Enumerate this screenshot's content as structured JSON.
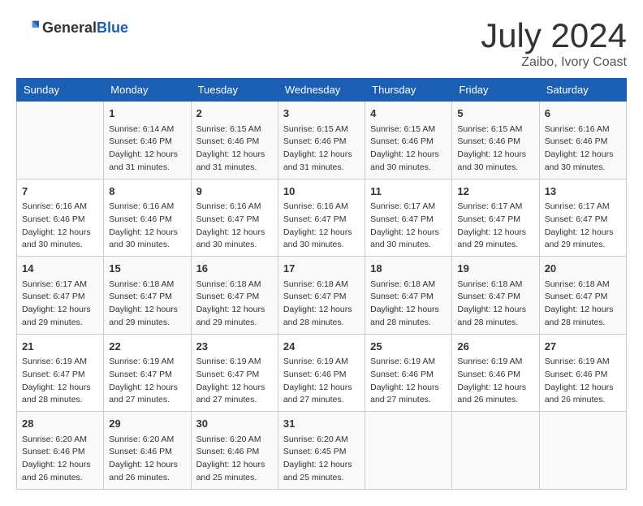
{
  "header": {
    "logo_general": "General",
    "logo_blue": "Blue",
    "month_year": "July 2024",
    "location": "Zaibo, Ivory Coast"
  },
  "days_of_week": [
    "Sunday",
    "Monday",
    "Tuesday",
    "Wednesday",
    "Thursday",
    "Friday",
    "Saturday"
  ],
  "weeks": [
    [
      {
        "day": "",
        "info": ""
      },
      {
        "day": "1",
        "info": "Sunrise: 6:14 AM\nSunset: 6:46 PM\nDaylight: 12 hours\nand 31 minutes."
      },
      {
        "day": "2",
        "info": "Sunrise: 6:15 AM\nSunset: 6:46 PM\nDaylight: 12 hours\nand 31 minutes."
      },
      {
        "day": "3",
        "info": "Sunrise: 6:15 AM\nSunset: 6:46 PM\nDaylight: 12 hours\nand 31 minutes."
      },
      {
        "day": "4",
        "info": "Sunrise: 6:15 AM\nSunset: 6:46 PM\nDaylight: 12 hours\nand 30 minutes."
      },
      {
        "day": "5",
        "info": "Sunrise: 6:15 AM\nSunset: 6:46 PM\nDaylight: 12 hours\nand 30 minutes."
      },
      {
        "day": "6",
        "info": "Sunrise: 6:16 AM\nSunset: 6:46 PM\nDaylight: 12 hours\nand 30 minutes."
      }
    ],
    [
      {
        "day": "7",
        "info": "Sunrise: 6:16 AM\nSunset: 6:46 PM\nDaylight: 12 hours\nand 30 minutes."
      },
      {
        "day": "8",
        "info": "Sunrise: 6:16 AM\nSunset: 6:46 PM\nDaylight: 12 hours\nand 30 minutes."
      },
      {
        "day": "9",
        "info": "Sunrise: 6:16 AM\nSunset: 6:47 PM\nDaylight: 12 hours\nand 30 minutes."
      },
      {
        "day": "10",
        "info": "Sunrise: 6:16 AM\nSunset: 6:47 PM\nDaylight: 12 hours\nand 30 minutes."
      },
      {
        "day": "11",
        "info": "Sunrise: 6:17 AM\nSunset: 6:47 PM\nDaylight: 12 hours\nand 30 minutes."
      },
      {
        "day": "12",
        "info": "Sunrise: 6:17 AM\nSunset: 6:47 PM\nDaylight: 12 hours\nand 29 minutes."
      },
      {
        "day": "13",
        "info": "Sunrise: 6:17 AM\nSunset: 6:47 PM\nDaylight: 12 hours\nand 29 minutes."
      }
    ],
    [
      {
        "day": "14",
        "info": "Sunrise: 6:17 AM\nSunset: 6:47 PM\nDaylight: 12 hours\nand 29 minutes."
      },
      {
        "day": "15",
        "info": "Sunrise: 6:18 AM\nSunset: 6:47 PM\nDaylight: 12 hours\nand 29 minutes."
      },
      {
        "day": "16",
        "info": "Sunrise: 6:18 AM\nSunset: 6:47 PM\nDaylight: 12 hours\nand 29 minutes."
      },
      {
        "day": "17",
        "info": "Sunrise: 6:18 AM\nSunset: 6:47 PM\nDaylight: 12 hours\nand 28 minutes."
      },
      {
        "day": "18",
        "info": "Sunrise: 6:18 AM\nSunset: 6:47 PM\nDaylight: 12 hours\nand 28 minutes."
      },
      {
        "day": "19",
        "info": "Sunrise: 6:18 AM\nSunset: 6:47 PM\nDaylight: 12 hours\nand 28 minutes."
      },
      {
        "day": "20",
        "info": "Sunrise: 6:18 AM\nSunset: 6:47 PM\nDaylight: 12 hours\nand 28 minutes."
      }
    ],
    [
      {
        "day": "21",
        "info": "Sunrise: 6:19 AM\nSunset: 6:47 PM\nDaylight: 12 hours\nand 28 minutes."
      },
      {
        "day": "22",
        "info": "Sunrise: 6:19 AM\nSunset: 6:47 PM\nDaylight: 12 hours\nand 27 minutes."
      },
      {
        "day": "23",
        "info": "Sunrise: 6:19 AM\nSunset: 6:47 PM\nDaylight: 12 hours\nand 27 minutes."
      },
      {
        "day": "24",
        "info": "Sunrise: 6:19 AM\nSunset: 6:46 PM\nDaylight: 12 hours\nand 27 minutes."
      },
      {
        "day": "25",
        "info": "Sunrise: 6:19 AM\nSunset: 6:46 PM\nDaylight: 12 hours\nand 27 minutes."
      },
      {
        "day": "26",
        "info": "Sunrise: 6:19 AM\nSunset: 6:46 PM\nDaylight: 12 hours\nand 26 minutes."
      },
      {
        "day": "27",
        "info": "Sunrise: 6:19 AM\nSunset: 6:46 PM\nDaylight: 12 hours\nand 26 minutes."
      }
    ],
    [
      {
        "day": "28",
        "info": "Sunrise: 6:20 AM\nSunset: 6:46 PM\nDaylight: 12 hours\nand 26 minutes."
      },
      {
        "day": "29",
        "info": "Sunrise: 6:20 AM\nSunset: 6:46 PM\nDaylight: 12 hours\nand 26 minutes."
      },
      {
        "day": "30",
        "info": "Sunrise: 6:20 AM\nSunset: 6:46 PM\nDaylight: 12 hours\nand 25 minutes."
      },
      {
        "day": "31",
        "info": "Sunrise: 6:20 AM\nSunset: 6:45 PM\nDaylight: 12 hours\nand 25 minutes."
      },
      {
        "day": "",
        "info": ""
      },
      {
        "day": "",
        "info": ""
      },
      {
        "day": "",
        "info": ""
      }
    ]
  ]
}
